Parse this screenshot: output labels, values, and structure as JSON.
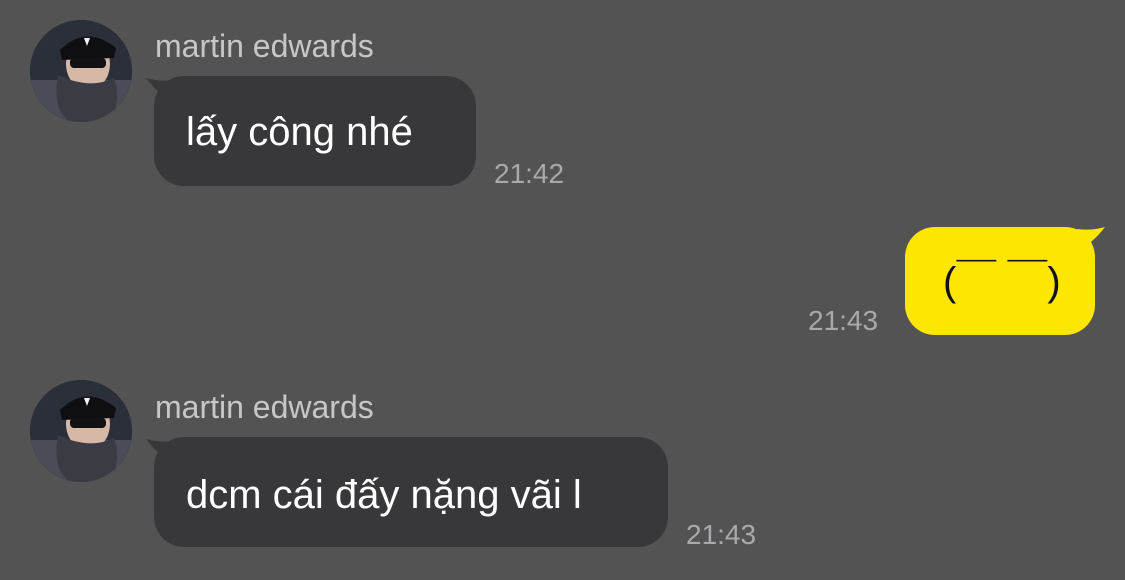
{
  "conversation": {
    "messages": [
      {
        "sender": "martin edwards",
        "text": "lấy công nhé",
        "time": "21:42",
        "direction": "incoming"
      },
      {
        "text": "(￣ ￣)",
        "time": "21:43",
        "direction": "outgoing"
      },
      {
        "sender": "martin edwards",
        "text": "dcm cái đấy nặng vãi l",
        "time": "21:43",
        "direction": "incoming"
      }
    ]
  },
  "colors": {
    "background": "#545354",
    "incoming_bubble": "#38383a",
    "outgoing_bubble": "#fde600",
    "sender_text": "#c7c6c8",
    "time_text": "#a9a8aa"
  },
  "icons": {
    "avatar": "user-avatar-photo"
  }
}
